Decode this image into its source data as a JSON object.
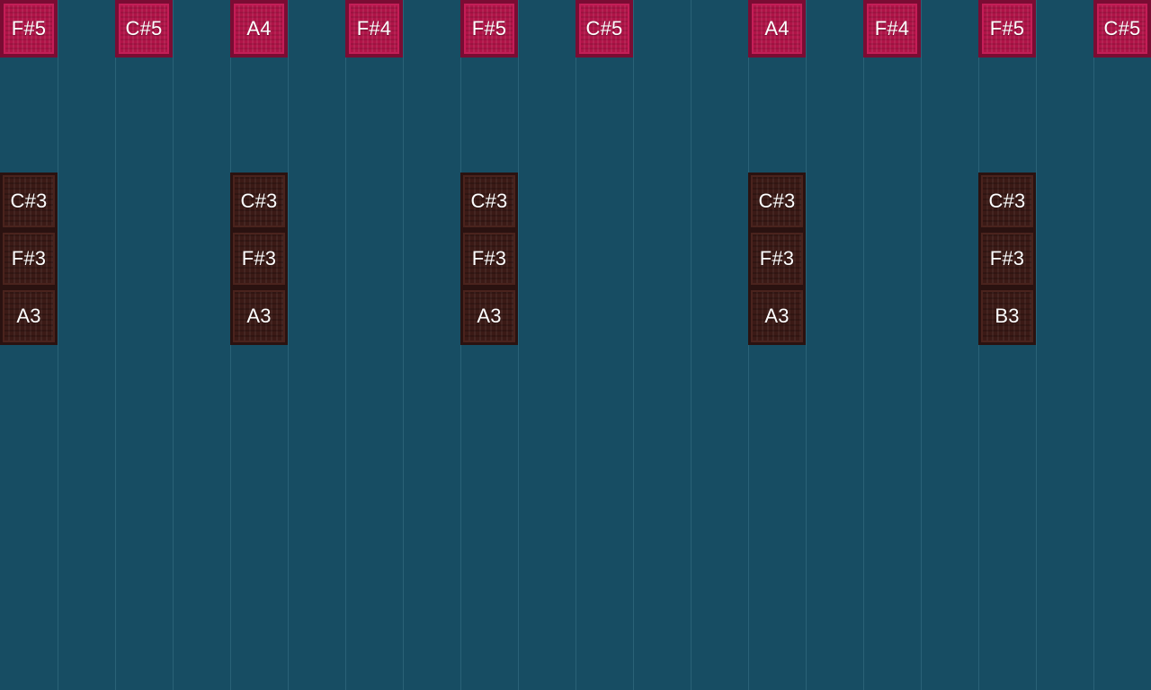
{
  "colors": {
    "background": "#174d63",
    "grid_line": "#2a6277",
    "high_block": "#b01448",
    "low_block": "#3b1a16",
    "label": "#ffffff"
  },
  "columns": [
    {
      "high": "F#5",
      "low": [
        "C#3",
        "F#3",
        "A3"
      ]
    },
    {
      "high": null,
      "low": []
    },
    {
      "high": "C#5",
      "low": []
    },
    {
      "high": null,
      "low": []
    },
    {
      "high": "A4",
      "low": [
        "C#3",
        "F#3",
        "A3"
      ]
    },
    {
      "high": null,
      "low": []
    },
    {
      "high": "F#4",
      "low": []
    },
    {
      "high": null,
      "low": []
    },
    {
      "high": "F#5",
      "low": [
        "C#3",
        "F#3",
        "A3"
      ]
    },
    {
      "high": null,
      "low": []
    },
    {
      "high": "C#5",
      "low": []
    },
    {
      "high": null,
      "low": []
    },
    {
      "high": null,
      "low": []
    },
    {
      "high": "A4",
      "low": [
        "C#3",
        "F#3",
        "A3"
      ]
    },
    {
      "high": null,
      "low": []
    },
    {
      "high": "F#4",
      "low": []
    },
    {
      "high": null,
      "low": []
    },
    {
      "high": "F#5",
      "low": [
        "C#3",
        "F#3",
        "B3"
      ]
    },
    {
      "high": null,
      "low": []
    },
    {
      "high": "C#5",
      "low": []
    }
  ]
}
